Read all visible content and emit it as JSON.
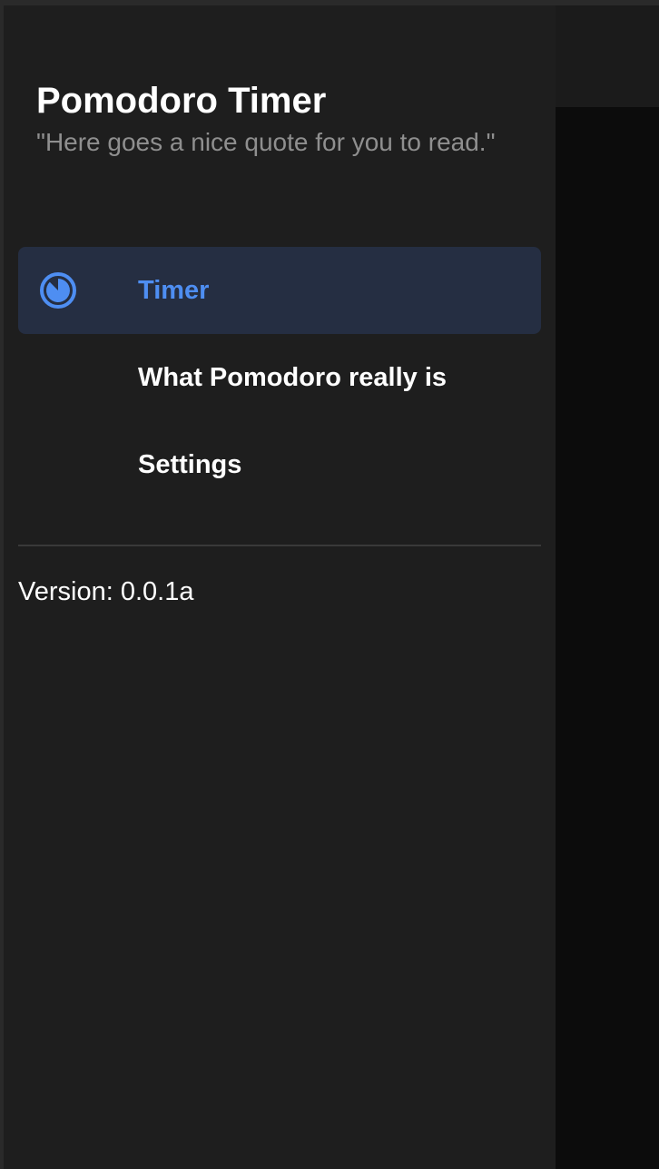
{
  "drawer": {
    "title": "Pomodoro Timer",
    "quote": "\"Here goes a nice quote for you to read.\"",
    "items": [
      {
        "label": "Timer",
        "icon": "timer-icon",
        "active": true
      },
      {
        "label": "What Pomodoro really is",
        "icon": "",
        "active": false
      },
      {
        "label": "Settings",
        "icon": "",
        "active": false
      }
    ],
    "version": "Version: 0.0.1a"
  },
  "colors": {
    "drawer_bg": "#1e1e1e",
    "app_bar_bg": "#1b1b1b",
    "scrim_bg": "#0c0c0c",
    "active_item_bg": "#252e42",
    "accent": "#4e8ef2",
    "text_primary": "#ffffff",
    "text_secondary": "#8f8f8f",
    "divider": "#3a3a3a"
  }
}
